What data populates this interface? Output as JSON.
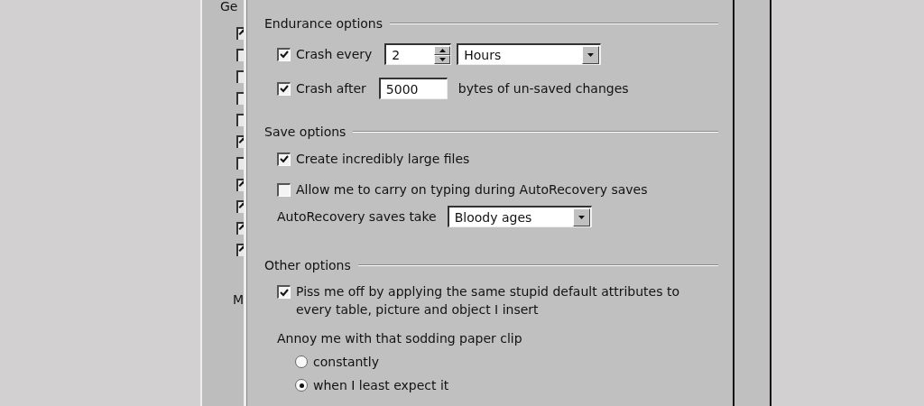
{
  "background_window": {
    "tab_label": "Ge",
    "checkboxes": [
      {
        "checked": true
      },
      {
        "checked": false
      },
      {
        "checked": false
      },
      {
        "checked": false
      },
      {
        "checked": false
      },
      {
        "checked": true
      },
      {
        "checked": false
      },
      {
        "checked": true
      },
      {
        "checked": true
      },
      {
        "checked": true
      },
      {
        "checked": true
      }
    ],
    "label": "M"
  },
  "dialog": {
    "groups": [
      {
        "title": "Endurance options",
        "rows": [
          {
            "kind": "spin",
            "checked": true,
            "label": "Crash every",
            "value": "2",
            "unit": "Hours"
          },
          {
            "kind": "field",
            "checked": true,
            "label": "Crash after",
            "value": "5000",
            "suffix": "bytes of un-saved changes"
          }
        ]
      },
      {
        "title": "Save options",
        "rows": [
          {
            "kind": "check",
            "checked": true,
            "label": "Create incredibly large files"
          },
          {
            "kind": "check",
            "checked": false,
            "label": "Allow me to carry on typing during AutoRecovery saves"
          },
          {
            "kind": "select",
            "label": "AutoRecovery saves take",
            "value": "Bloody ages"
          }
        ]
      },
      {
        "title": "Other options",
        "rows": [
          {
            "kind": "check",
            "checked": true,
            "label": "Piss me off by applying the same stupid default attributes to every table, picture and object I insert"
          },
          {
            "kind": "radio_group",
            "label": "Annoy me with that sodding paper clip",
            "options": [
              {
                "label": "constantly",
                "selected": false
              },
              {
                "label": "when I least expect it",
                "selected": true
              }
            ]
          }
        ]
      }
    ]
  }
}
